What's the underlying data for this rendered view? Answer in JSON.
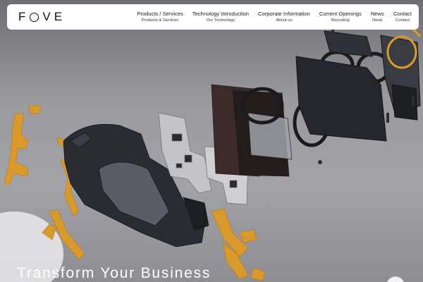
{
  "brand": {
    "logo_text_left": "F",
    "logo_text_right": "VE"
  },
  "nav": [
    {
      "en": "Products / Services",
      "sub": "Products & Services"
    },
    {
      "en": "Technology Introduction",
      "sub": "Our Technology"
    },
    {
      "en": "Corporate Information",
      "sub": "About us"
    },
    {
      "en": "Current Openings",
      "sub": "Recruiting"
    },
    {
      "en": "News",
      "sub": "News"
    },
    {
      "en": "Contact",
      "sub": "Contact"
    }
  ],
  "hero": {
    "title": "Transform Your Business"
  },
  "colors": {
    "header_bg": "#ffffff",
    "text_dark": "#111111",
    "hero_text": "#ffffff",
    "flex_cable": "#d99a2b",
    "frame_dark": "#2a2c33",
    "pcb_gray": "#b9b9bd"
  }
}
